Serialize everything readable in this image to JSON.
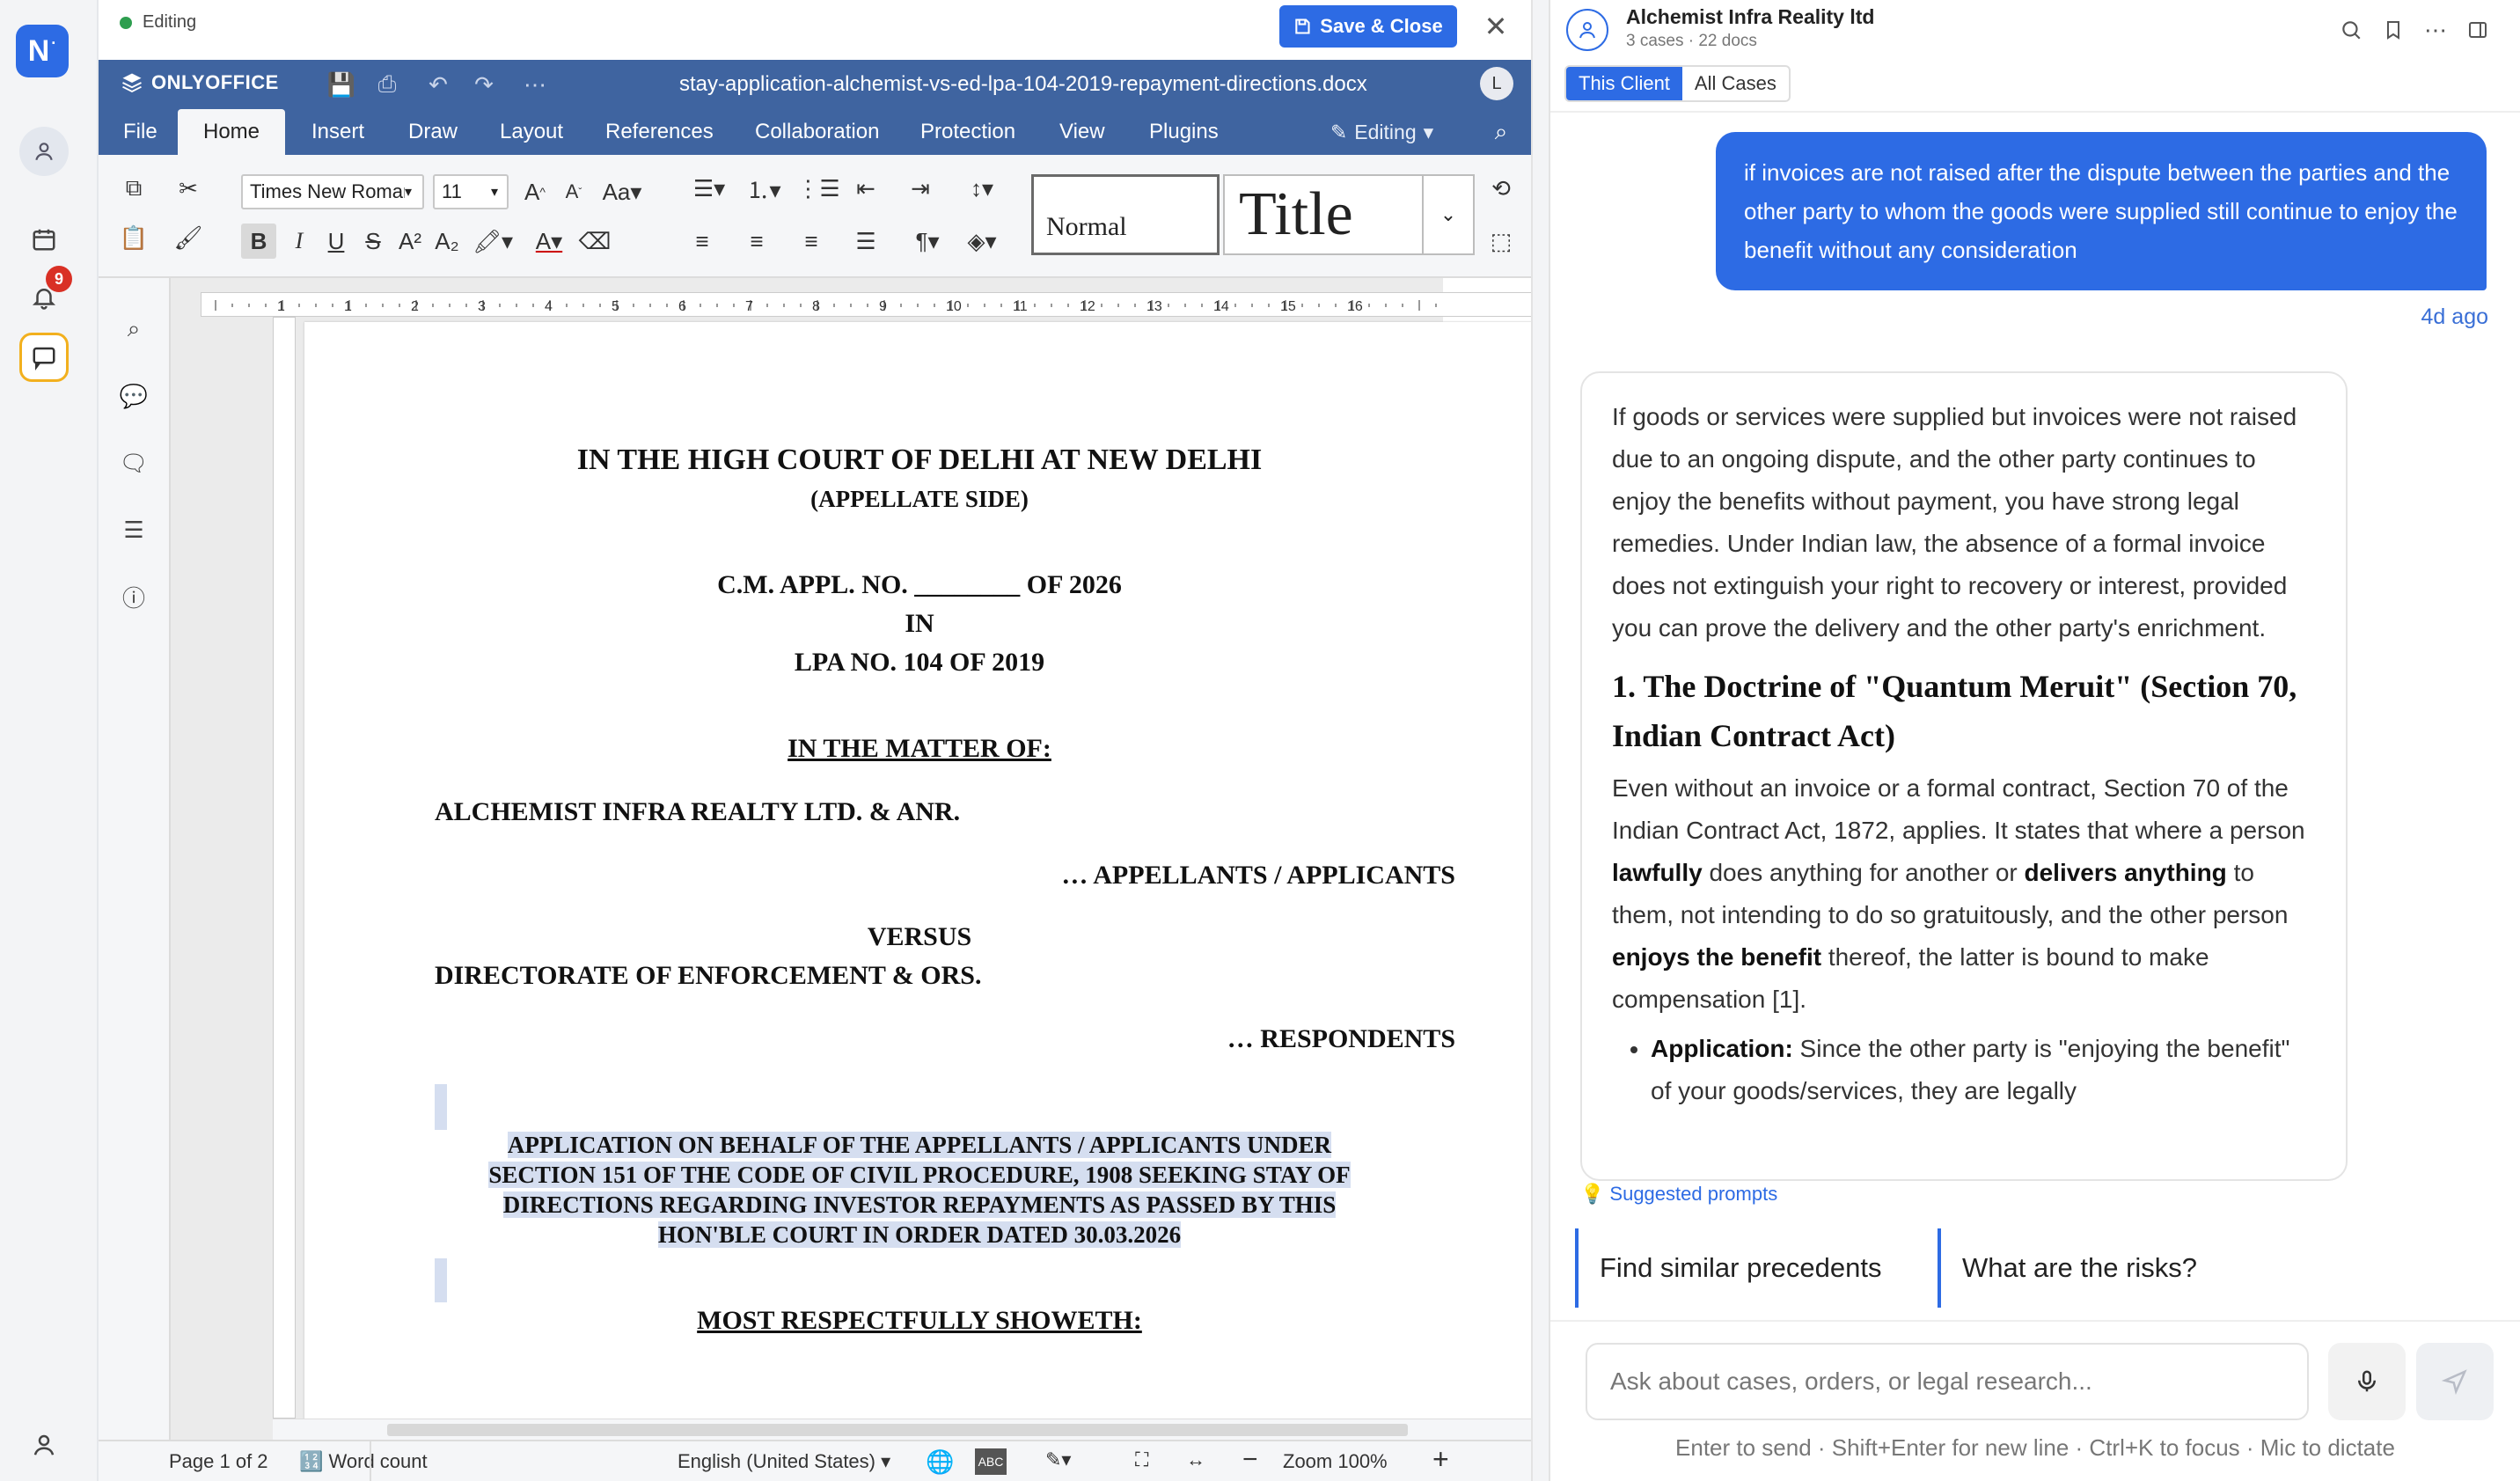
{
  "app": {
    "logo_text": "N",
    "notification_count": "9"
  },
  "editor": {
    "status_text": "Editing",
    "save_close_label": "Save & Close",
    "oo_brand": "ONLYOFFICE",
    "doc_title": "stay-application-alchemist-vs-ed-lpa-104-2019-repayment-directions.docx",
    "user_initial": "L",
    "menu": [
      "File",
      "Home",
      "Insert",
      "Draw",
      "Layout",
      "References",
      "Collaboration",
      "Protection",
      "View",
      "Plugins"
    ],
    "active_menu": "Home",
    "mode_label": "Editing",
    "font_name": "Times New Roman",
    "font_size": "11",
    "styles": {
      "normal": "Normal",
      "title": "Title"
    },
    "status_bar": {
      "page": "Page 1 of 2",
      "word_count": "Word count",
      "language": "English (United States)",
      "zoom": "Zoom 100%"
    },
    "ruler_marks": [
      "1",
      "1",
      "2",
      "3",
      "4",
      "5",
      "6",
      "7",
      "8",
      "9",
      "10",
      "11",
      "12",
      "13",
      "14",
      "15",
      "16"
    ],
    "document": {
      "court": "IN THE HIGH COURT OF DELHI AT NEW DELHI",
      "side": "(APPELLATE SIDE)",
      "cm_appl": "C.M. APPL. NO. ________ OF 2026",
      "in": "IN",
      "lpa": "LPA NO. 104 OF 2019",
      "matter": "IN THE MATTER OF:",
      "appellant": "ALCHEMIST INFRA REALTY LTD. & ANR.",
      "appellant_role": "… APPELLANTS / APPLICANTS",
      "versus": "VERSUS",
      "respondent": "DIRECTORATE OF ENFORCEMENT & ORS.",
      "respondent_role": "… RESPONDENTS",
      "application_lines": [
        "APPLICATION ON BEHALF OF THE APPELLANTS / APPLICANTS UNDER",
        "SECTION 151 OF THE CODE OF CIVIL PROCEDURE, 1908 SEEKING STAY OF",
        "DIRECTIONS REGARDING INVESTOR REPAYMENTS AS PASSED BY THIS",
        "HON'BLE COURT IN ORDER DATED 30.03.2026"
      ],
      "showeth": "MOST RESPECTFULLY SHOWETH:"
    }
  },
  "chat": {
    "client_name": "Alchemist Infra Reality ltd",
    "client_meta": "3 cases · 22 docs",
    "tabs": [
      "This Client",
      "All Cases"
    ],
    "user_message": "if invoices are not raised after the dispute between the parties and the other party to whom the goods were supplied still continue to enjoy the benefit without any consideration",
    "message_time": "4d ago",
    "ai_intro": "If goods or services were supplied but invoices were not raised due to an ongoing dispute, and the other party continues to enjoy the benefits without payment, you have strong legal remedies. Under Indian law, the absence of a formal invoice does not extinguish your right to recovery or interest, provided you can prove the delivery and the other party's enrichment.",
    "ai_heading": "1. The Doctrine of \"Quantum Meruit\" (Section 70, Indian Contract Act)",
    "ai_p2_a": "Even without an invoice or a formal contract, Section 70 of the Indian Contract Act, 1872, applies. It states that where a person ",
    "ai_p2_b1": "lawfully",
    "ai_p2_c": " does anything for another or ",
    "ai_p2_b2": "delivers anything",
    "ai_p2_d": " to them, not intending to do so gratuitously, and the other person ",
    "ai_p2_b3": "enjoys the benefit",
    "ai_p2_e": " thereof, the latter is bound to make compensation [1].",
    "ai_bullet_label": "Application:",
    "ai_bullet_text": " Since the other party is \"enjoying the benefit\" of your goods/services, they are legally",
    "suggested_label": "Suggested prompts",
    "prompts": [
      "Find similar precedents",
      "What are the risks?"
    ],
    "input_placeholder": "Ask about cases, orders, or legal research...",
    "hint": "Enter to send · Shift+Enter for new line · Ctrl+K to focus · Mic to dictate"
  },
  "colors": {
    "accent": "#2d6be4",
    "oo_header": "#3f64a0",
    "highlight": "#d5def0"
  }
}
